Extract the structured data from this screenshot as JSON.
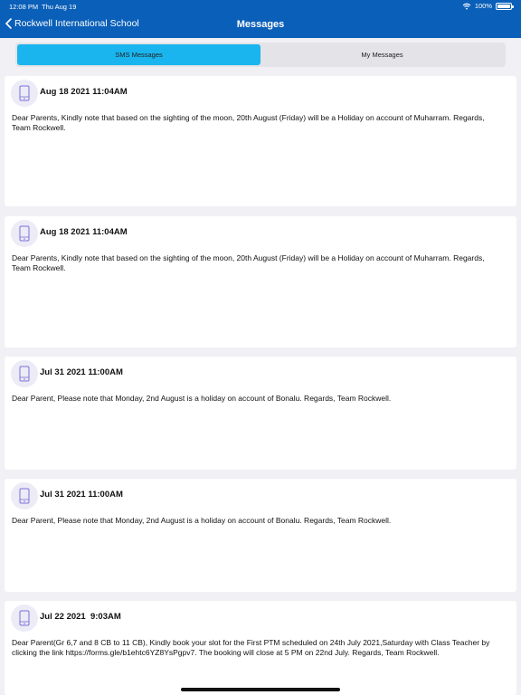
{
  "status_bar": {
    "time": "12:08 PM",
    "date": "Thu Aug 19",
    "battery": "100%"
  },
  "nav": {
    "back_label": "Rockwell International School",
    "title": "Messages"
  },
  "tabs": [
    {
      "label": "SMS Messages",
      "active": true
    },
    {
      "label": "My Messages",
      "active": false
    }
  ],
  "messages": [
    {
      "date": "Aug 18 2021 11:04AM",
      "body": "Dear Parents, Kindly note that based on the sighting of the moon, 20th August (Friday) will be a Holiday on account of Muharram. Regards, Team Rockwell."
    },
    {
      "date": "Aug 18 2021 11:04AM",
      "body": "Dear Parents, Kindly note that based on the sighting of the moon, 20th August (Friday) will be a Holiday on account of Muharram. Regards, Team Rockwell."
    },
    {
      "date": "Jul 31 2021 11:00AM",
      "body": "Dear Parent, Please note that Monday, 2nd August is a holiday on account of Bonalu. Regards, Team Rockwell."
    },
    {
      "date": "Jul 31 2021 11:00AM",
      "body": "Dear Parent, Please note that Monday, 2nd August is a holiday on account of Bonalu. Regards, Team Rockwell."
    },
    {
      "date": "Jul 22 2021  9:03AM",
      "body": "Dear Parent(Gr 6,7 and 8 CB to 11 CB), Kindly book your slot for the First PTM scheduled on 24th July 2021,Saturday with Class Teacher by clicking the link https://forms.gle/b1ehtc6YZ8YsPgpv7. The booking will close at 5 PM on 22nd July. Regards, Team Rockwell."
    }
  ],
  "colors": {
    "nav_background": "#0a5fb8",
    "active_tab": "#1ab5ee",
    "icon_circle": "#ecebf6",
    "icon_stroke": "#7a72d9"
  },
  "icons": {
    "back": "chevron-left-icon",
    "wifi": "wifi-icon",
    "battery": "battery-icon",
    "message": "mobile-phone-icon"
  }
}
